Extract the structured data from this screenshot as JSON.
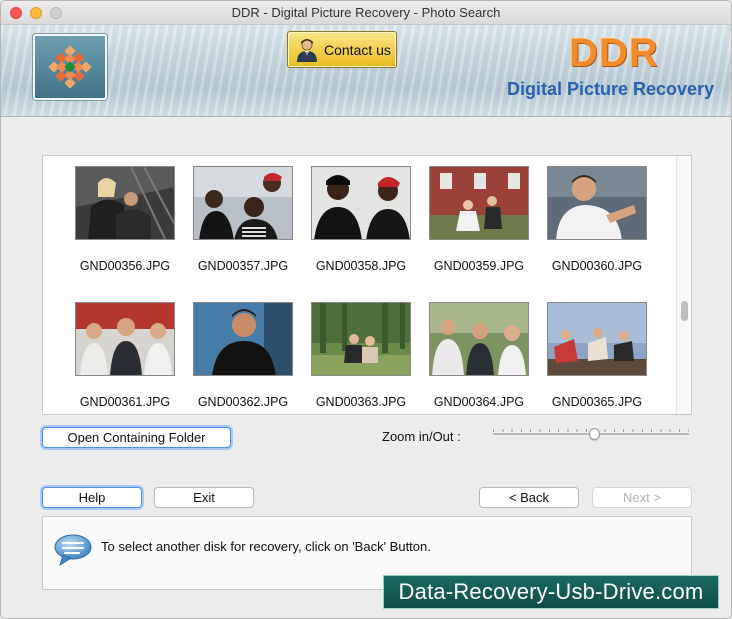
{
  "window": {
    "title": "DDR - Digital Picture Recovery - Photo Search"
  },
  "header": {
    "contact_label": "Contact us",
    "brand": "DDR",
    "product": "Digital Picture Recovery"
  },
  "gallery": {
    "items": [
      {
        "name": "GND00356.JPG"
      },
      {
        "name": "GND00357.JPG"
      },
      {
        "name": "GND00358.JPG"
      },
      {
        "name": "GND00359.JPG"
      },
      {
        "name": "GND00360.JPG"
      },
      {
        "name": "GND00361.JPG"
      },
      {
        "name": "GND00362.JPG"
      },
      {
        "name": "GND00363.JPG"
      },
      {
        "name": "GND00364.JPG"
      },
      {
        "name": "GND00365.JPG"
      }
    ]
  },
  "controls": {
    "open_folder_label": "Open Containing Folder",
    "zoom_label": "Zoom in/Out :",
    "zoom_level": 0.52
  },
  "buttons": {
    "help": "Help",
    "exit": "Exit",
    "back": "< Back",
    "next": "Next >"
  },
  "status": {
    "message": "To select another disk for recovery, click on 'Back' Button."
  },
  "watermark": "Data-Recovery-Usb-Drive.com",
  "colors": {
    "accent_orange": "#f28c2a",
    "accent_blue": "#2a62b0",
    "watermark_bg": "#1a6b62"
  }
}
